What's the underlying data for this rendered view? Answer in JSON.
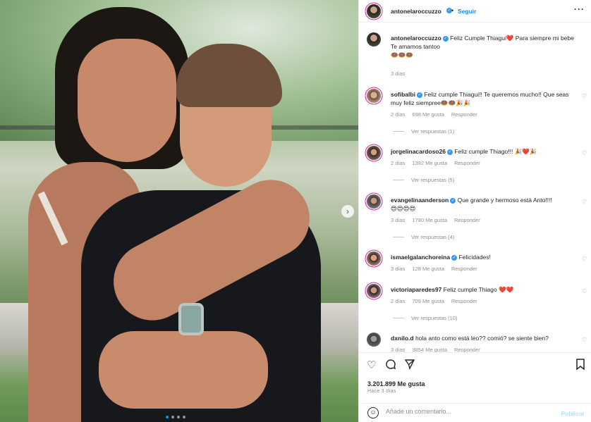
{
  "post": {
    "author": "antonelaroccuzzo",
    "follow_label": "Seguir",
    "follow_sep": "•",
    "more_label": "···",
    "caption_line1": "Feliz Cumple Thiagui❤️ Para siempre mi bebe",
    "caption_line2": "Te amamos tantoo",
    "caption_emojis": "🍩🍩🍩",
    "caption_time": "3 días",
    "image_nav_next": "›",
    "carousel_dots": 4,
    "carousel_active": 0
  },
  "comments": [
    {
      "user": "sofibalbi",
      "text": "Feliz cumple Thiagui!! Te queremos mucho!! Que seas muy feliz siempree🍩🍩🎉🎉",
      "time": "2 días",
      "likes": "698 Me gusta",
      "reply": "Responder",
      "replies": "Ver respuestas (1)"
    },
    {
      "user": "jorgelinacardoso26",
      "text": "Feliz cumple Thiago!!! 🎉❤️🎉",
      "time": "2 días",
      "likes": "1392 Me gusta",
      "reply": "Responder",
      "replies": "Ver respuestas (5)"
    },
    {
      "user": "evangelinaanderson",
      "text": "Que grande y hermoso está Anto!!!!",
      "emojis": "😍😍😍😍",
      "time": "3 días",
      "likes": "1780 Me gusta",
      "reply": "Responder",
      "replies": "Ver respuestas (4)"
    },
    {
      "user": "ismaelgalanchoreina",
      "text": "Felicidades!",
      "time": "3 días",
      "likes": "128 Me gusta",
      "reply": "Responder"
    },
    {
      "user": "victoriaparedes97",
      "text": "Feliz cumple Thiago ❤️❤️",
      "time": "2 días",
      "likes": "709 Me gusta",
      "reply": "Responder",
      "replies": "Ver respuestas (10)"
    },
    {
      "user": "dxnilo.d",
      "text": "hola anto como está leo?? comió? se siente bien?",
      "time": "3 días",
      "likes": "3854 Me gusta",
      "reply": "Responder"
    }
  ],
  "actions": {
    "likes": "3.201.899 Me gusta",
    "when": "Hace 3 días"
  },
  "add_comment": {
    "placeholder": "Añade un comentario...",
    "publish_label": "Publicar"
  },
  "icons": {
    "like": "heart-icon",
    "comment": "comment-icon",
    "share": "paper-plane-icon",
    "save": "bookmark-icon",
    "emoji": "emoji-icon",
    "verified": "verified-badge-icon"
  },
  "colors": {
    "accent": "#0095f6",
    "muted": "#8e8e8e",
    "text": "#262626",
    "verified": "#3897f0"
  }
}
